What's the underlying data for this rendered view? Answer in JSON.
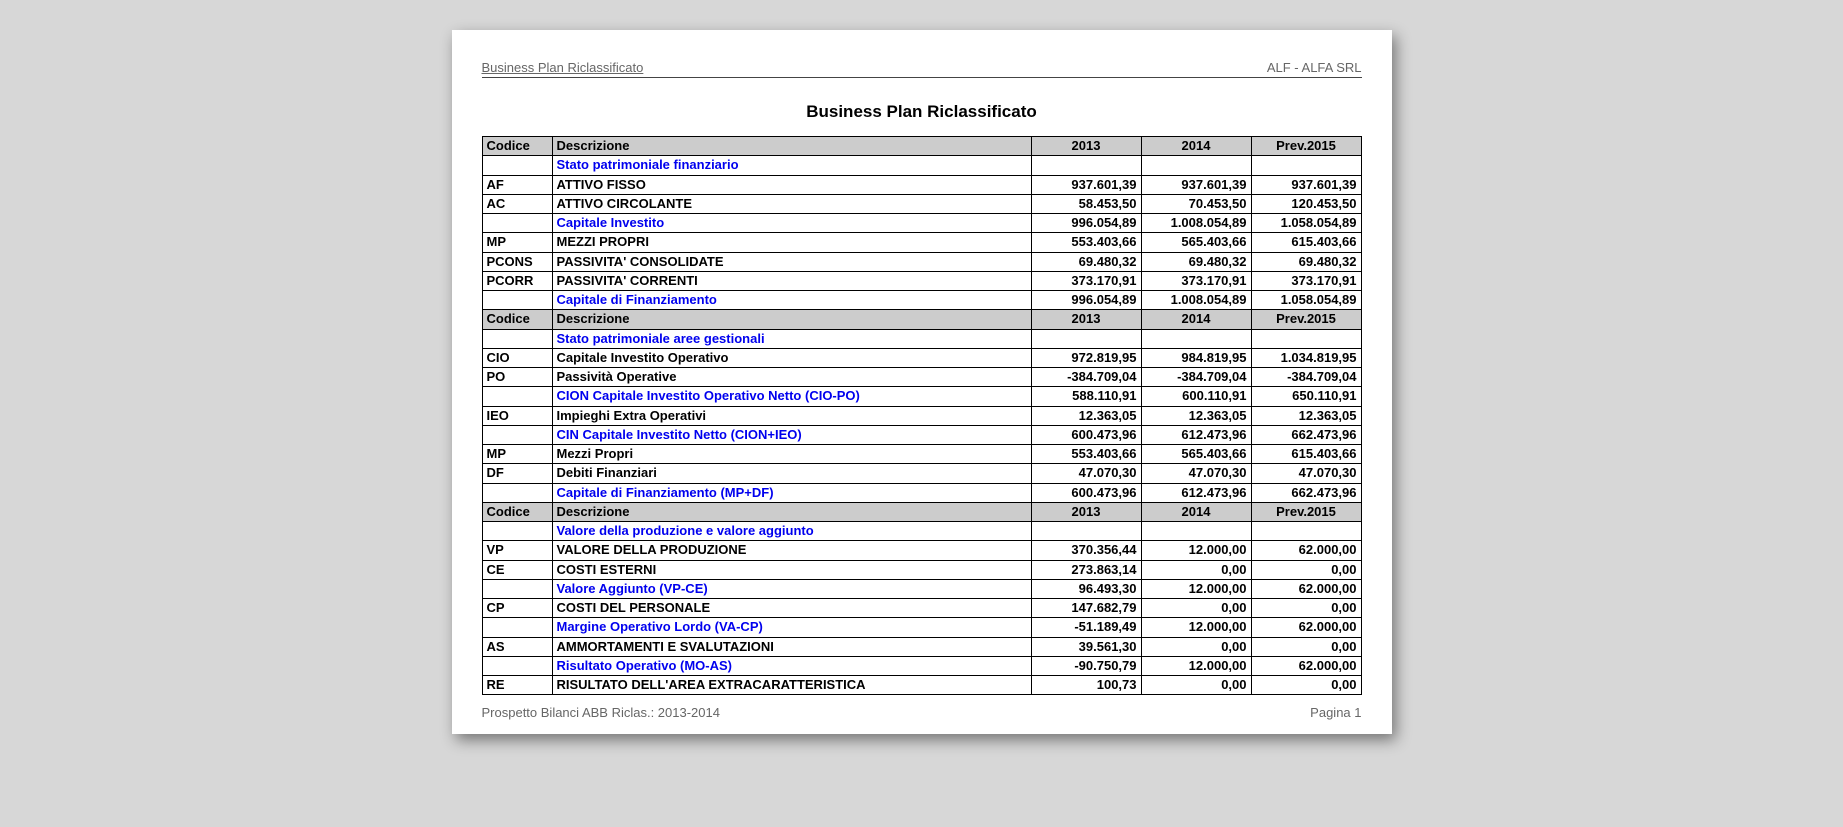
{
  "header": {
    "left": "Business Plan Riclassificato",
    "right": "ALF - ALFA SRL"
  },
  "title": "Business Plan Riclassificato",
  "columns": {
    "code": "Codice",
    "desc": "Descrizione",
    "y1": "2013",
    "y2": "2014",
    "y3": "Prev.2015"
  },
  "footer": {
    "left": "Prospetto Bilanci ABB Riclas.: 2013-2014",
    "right": "Pagina 1"
  },
  "rows": [
    {
      "type": "header"
    },
    {
      "type": "section",
      "desc": "Stato patrimoniale finanziario"
    },
    {
      "type": "data",
      "code": "AF",
      "desc": "ATTIVO FISSO",
      "y1": "937.601,39",
      "y2": "937.601,39",
      "y3": "937.601,39"
    },
    {
      "type": "data",
      "code": "AC",
      "desc": "ATTIVO CIRCOLANTE",
      "y1": "58.453,50",
      "y2": "70.453,50",
      "y3": "120.453,50"
    },
    {
      "type": "sectiondata",
      "desc": "Capitale Investito",
      "y1": "996.054,89",
      "y2": "1.008.054,89",
      "y3": "1.058.054,89"
    },
    {
      "type": "data",
      "code": "MP",
      "desc": "MEZZI PROPRI",
      "y1": "553.403,66",
      "y2": "565.403,66",
      "y3": "615.403,66"
    },
    {
      "type": "data",
      "code": "PCONS",
      "desc": "PASSIVITA' CONSOLIDATE",
      "y1": "69.480,32",
      "y2": "69.480,32",
      "y3": "69.480,32"
    },
    {
      "type": "data",
      "code": "PCORR",
      "desc": "PASSIVITA' CORRENTI",
      "y1": "373.170,91",
      "y2": "373.170,91",
      "y3": "373.170,91"
    },
    {
      "type": "sectiondata",
      "desc": "Capitale di Finanziamento",
      "y1": "996.054,89",
      "y2": "1.008.054,89",
      "y3": "1.058.054,89"
    },
    {
      "type": "header"
    },
    {
      "type": "section",
      "desc": "Stato patrimoniale aree gestionali"
    },
    {
      "type": "data",
      "code": "CIO",
      "desc": "Capitale Investito Operativo",
      "y1": "972.819,95",
      "y2": "984.819,95",
      "y3": "1.034.819,95"
    },
    {
      "type": "data",
      "code": "PO",
      "desc": "Passività Operative",
      "y1": "-384.709,04",
      "y2": "-384.709,04",
      "y3": "-384.709,04"
    },
    {
      "type": "sectiondata",
      "desc": "CION Capitale Investito Operativo Netto (CIO-PO)",
      "y1": "588.110,91",
      "y2": "600.110,91",
      "y3": "650.110,91"
    },
    {
      "type": "data",
      "code": "IEO",
      "desc": "Impieghi Extra Operativi",
      "y1": "12.363,05",
      "y2": "12.363,05",
      "y3": "12.363,05"
    },
    {
      "type": "sectiondata",
      "desc": "CIN Capitale Investito Netto (CION+IEO)",
      "y1": "600.473,96",
      "y2": "612.473,96",
      "y3": "662.473,96"
    },
    {
      "type": "data",
      "code": "MP",
      "desc": "Mezzi Propri",
      "y1": "553.403,66",
      "y2": "565.403,66",
      "y3": "615.403,66"
    },
    {
      "type": "data",
      "code": "DF",
      "desc": "Debiti Finanziari",
      "y1": "47.070,30",
      "y2": "47.070,30",
      "y3": "47.070,30"
    },
    {
      "type": "sectiondata",
      "desc": "Capitale di Finanziamento (MP+DF)",
      "y1": "600.473,96",
      "y2": "612.473,96",
      "y3": "662.473,96"
    },
    {
      "type": "header"
    },
    {
      "type": "section",
      "desc": "Valore della produzione e valore aggiunto"
    },
    {
      "type": "data",
      "code": "VP",
      "desc": "VALORE DELLA PRODUZIONE",
      "y1": "370.356,44",
      "y2": "12.000,00",
      "y3": "62.000,00"
    },
    {
      "type": "data",
      "code": "CE",
      "desc": "COSTI ESTERNI",
      "y1": "273.863,14",
      "y2": "0,00",
      "y3": "0,00"
    },
    {
      "type": "sectiondata",
      "desc": "Valore Aggiunto (VP-CE)",
      "y1": "96.493,30",
      "y2": "12.000,00",
      "y3": "62.000,00"
    },
    {
      "type": "data",
      "code": "CP",
      "desc": "COSTI DEL PERSONALE",
      "y1": "147.682,79",
      "y2": "0,00",
      "y3": "0,00"
    },
    {
      "type": "sectiondata",
      "desc": "Margine Operativo Lordo (VA-CP)",
      "y1": "-51.189,49",
      "y2": "12.000,00",
      "y3": "62.000,00"
    },
    {
      "type": "data",
      "code": "AS",
      "desc": "AMMORTAMENTI E SVALUTAZIONI",
      "y1": "39.561,30",
      "y2": "0,00",
      "y3": "0,00"
    },
    {
      "type": "sectiondata",
      "desc": "Risultato Operativo (MO-AS)",
      "y1": "-90.750,79",
      "y2": "12.000,00",
      "y3": "62.000,00"
    },
    {
      "type": "data",
      "code": "RE",
      "desc": "RISULTATO DELL'AREA EXTRACARATTERISTICA",
      "y1": "100,73",
      "y2": "0,00",
      "y3": "0,00"
    }
  ]
}
